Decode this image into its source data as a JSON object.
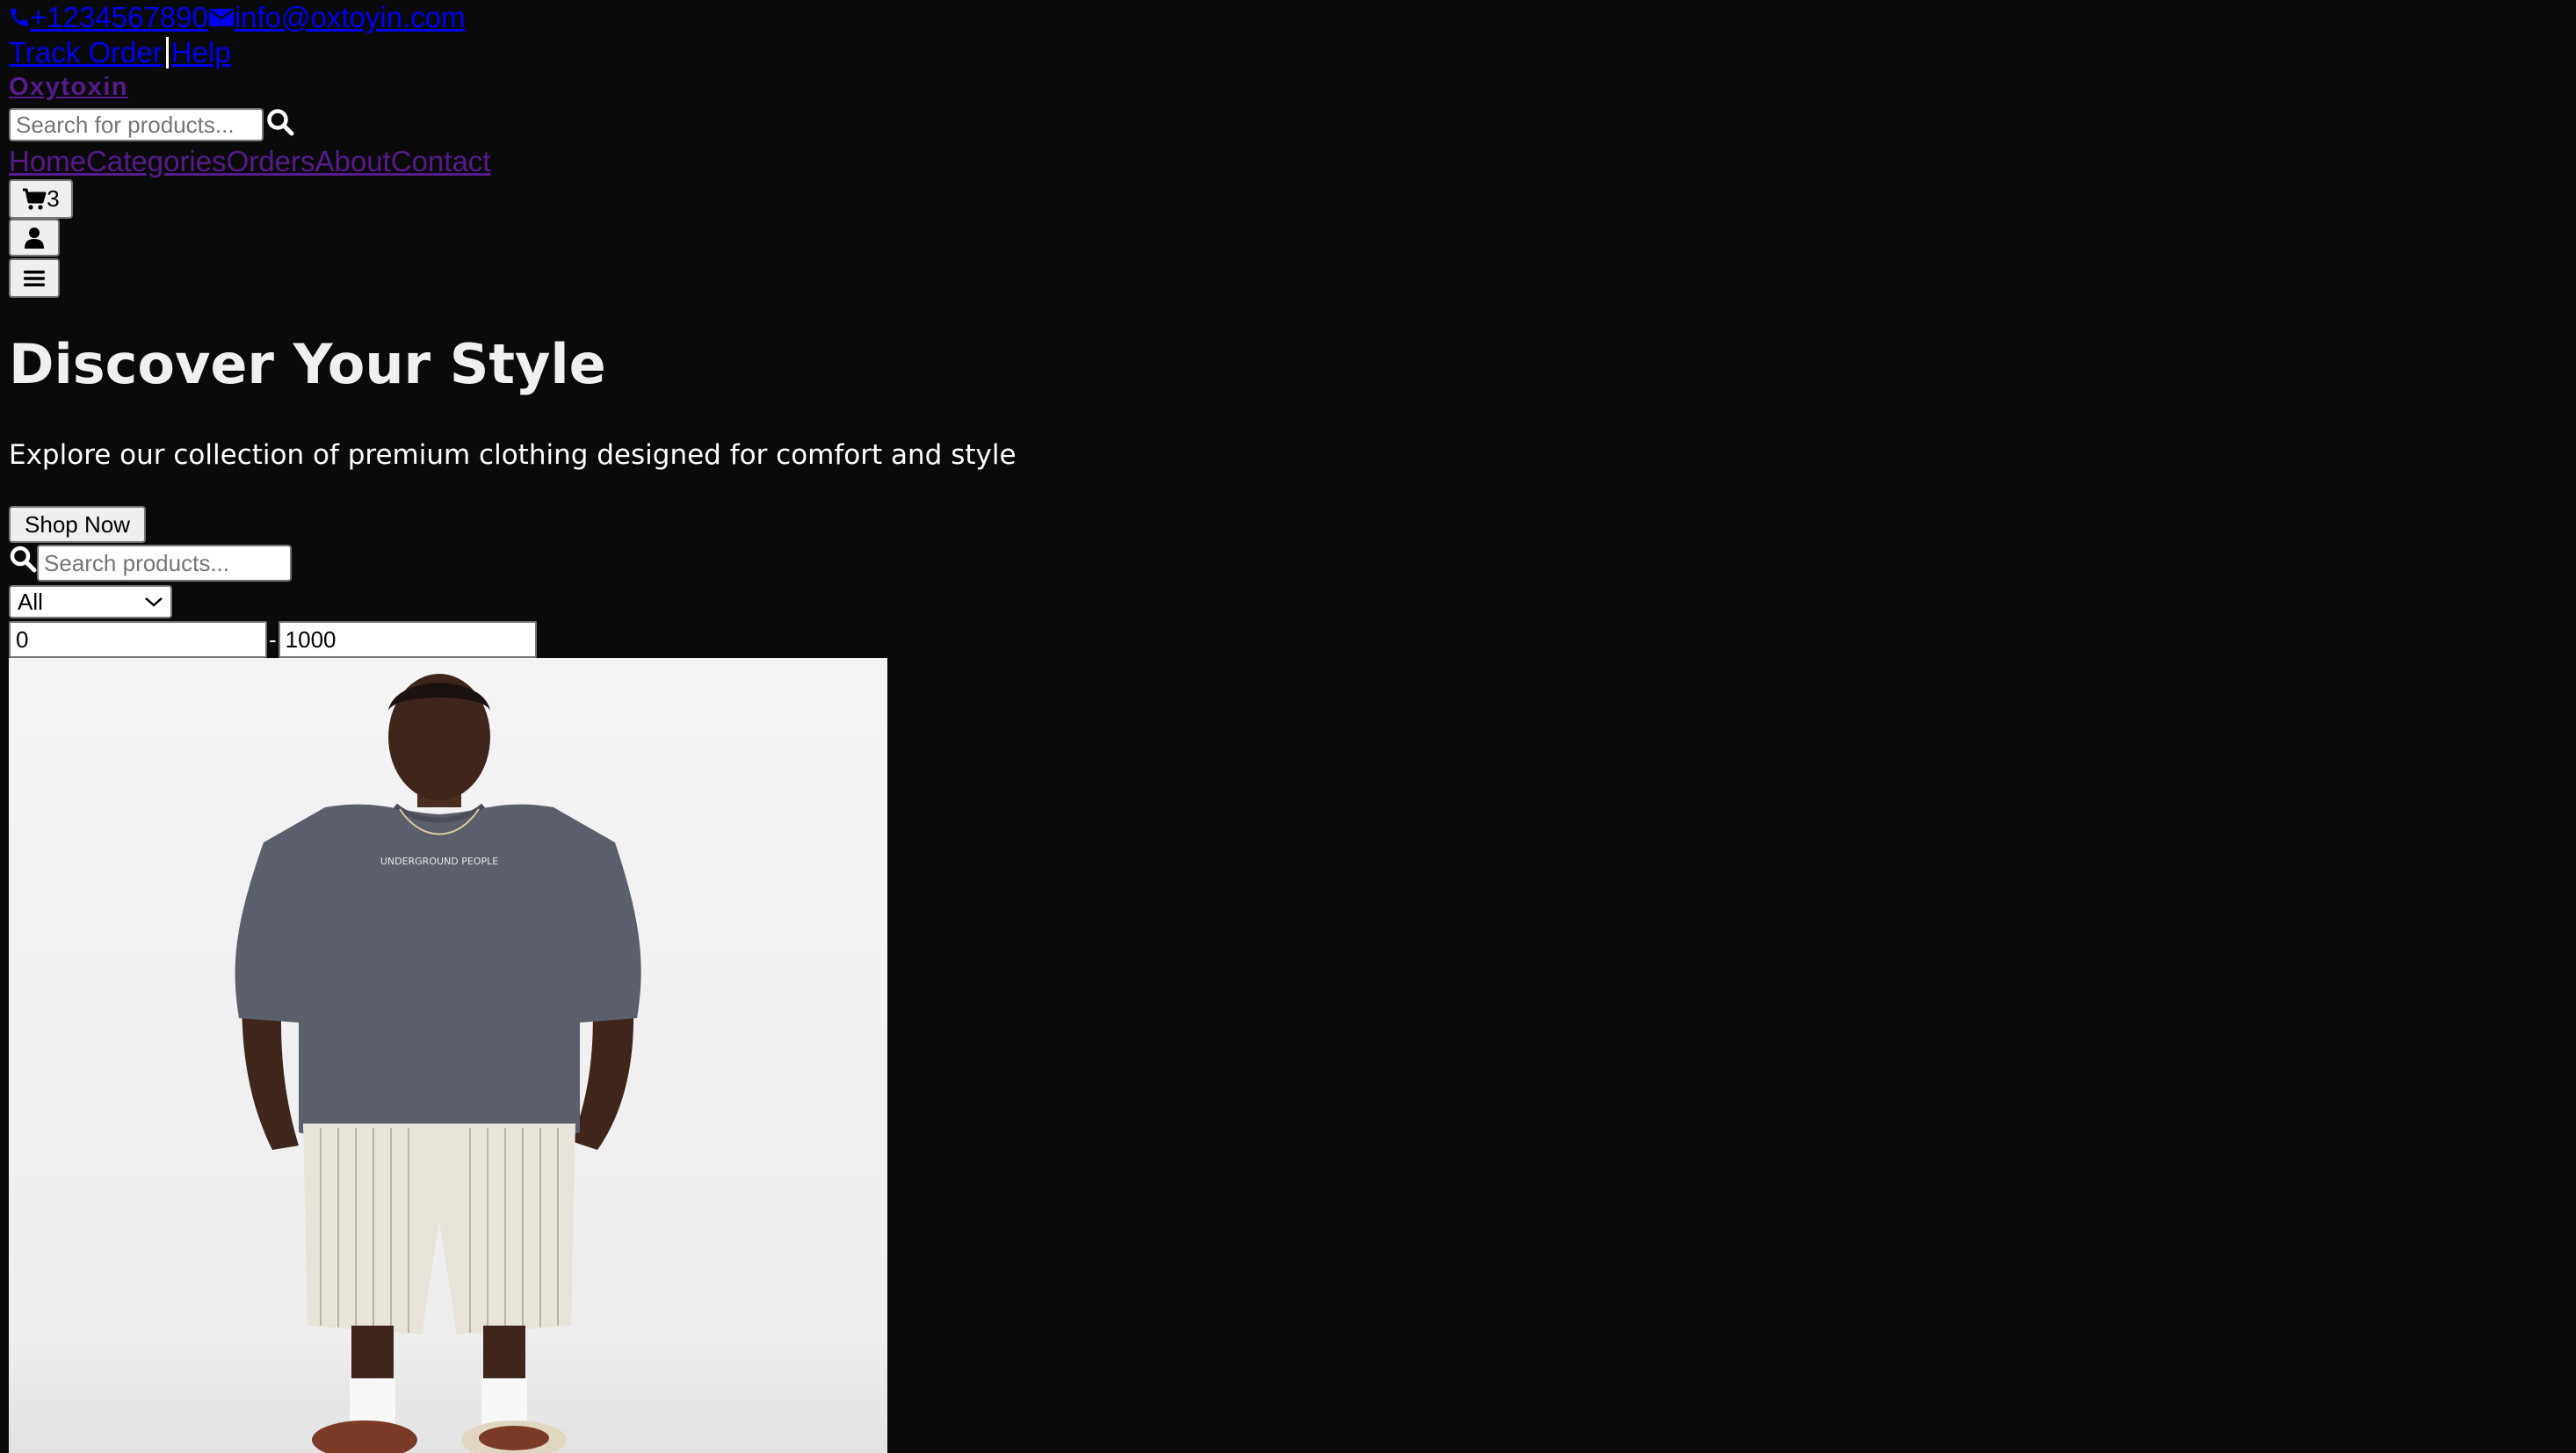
{
  "topbar": {
    "phone": "+1234567890",
    "email": "info@oxtoyin.com",
    "track_order": "Track Order",
    "help": "Help"
  },
  "brand": {
    "logo": "Oxytoxin"
  },
  "header_search": {
    "placeholder": "Search for products..."
  },
  "nav": {
    "items": [
      "Home",
      "Categories",
      "Orders",
      "About",
      "Contact"
    ]
  },
  "cart": {
    "count": "3"
  },
  "hero": {
    "title": "Discover Your Style",
    "subtitle": "Explore our collection of premium clothing designed for comfort and style",
    "cta": "Shop Now"
  },
  "filters": {
    "search_placeholder": "Search products...",
    "category_selected": "All",
    "price_min": "0",
    "price_max": "1000"
  },
  "product": {
    "shirt_print": "UNDERGROUND PEOPLE"
  },
  "icons": {
    "phone": "phone-icon",
    "email": "envelope-icon",
    "search": "search-icon",
    "cart": "cart-icon",
    "user": "user-icon",
    "menu": "menu-icon",
    "chevron": "chevron-down-icon"
  },
  "colors": {
    "page_background": "#0a0a0a",
    "link": "#0000ee",
    "visited_link": "#551a8b",
    "button_background": "#efefef"
  }
}
